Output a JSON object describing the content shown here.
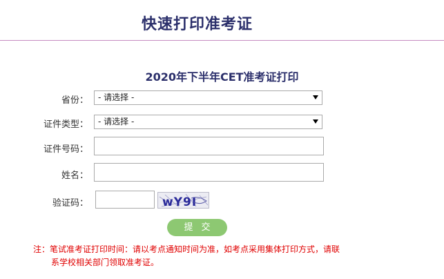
{
  "header": {
    "title": "快速打印准考证"
  },
  "form": {
    "title": "2020年下半年CET准考证打印",
    "province_label": "省份：",
    "province_value": "- 请选择 -",
    "id_type_label": "证件类型：",
    "id_type_value": "- 请选择 -",
    "id_number_label": "证件号码：",
    "name_label": "姓名：",
    "captcha_label": "验证码：",
    "captcha_text": "wY9I",
    "submit_label": "提交"
  },
  "note": {
    "line1": "注：笔试准考证打印时间：请以考点通知时间为准，如考点采用集体打印方式，请联",
    "line2": "系学校相关部门领取准考证。"
  },
  "colors": {
    "title": "#2b2f6b",
    "header_border": "#c58bc0",
    "submit_bg": "#8dc872",
    "note": "#e00000"
  }
}
